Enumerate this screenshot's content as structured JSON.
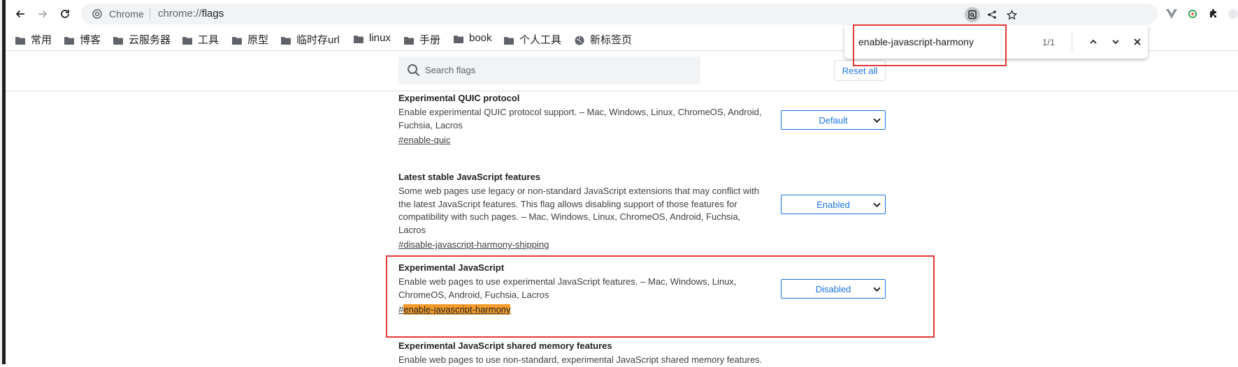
{
  "browser": {
    "omnibox": {
      "chip_label": "Chrome",
      "url_scheme": "chrome://",
      "url_path": "flags"
    }
  },
  "bookmarks": [
    {
      "label": "常用",
      "icon": "folder-icon"
    },
    {
      "label": "博客",
      "icon": "folder-icon"
    },
    {
      "label": "云服务器",
      "icon": "folder-icon"
    },
    {
      "label": "工具",
      "icon": "folder-icon"
    },
    {
      "label": "原型",
      "icon": "folder-icon"
    },
    {
      "label": "临时存url",
      "icon": "folder-icon"
    },
    {
      "label": "linux",
      "icon": "folder-icon"
    },
    {
      "label": "手册",
      "icon": "folder-icon"
    },
    {
      "label": "book",
      "icon": "folder-icon"
    },
    {
      "label": "个人工具",
      "icon": "folder-icon"
    },
    {
      "label": "新标签页",
      "icon": "globe-icon"
    }
  ],
  "findbar": {
    "query": "enable-javascript-harmony",
    "count": "1/1"
  },
  "flags_page": {
    "search_placeholder": "Search flags",
    "reset_label": "Reset all",
    "flags": [
      {
        "title": "Experimental QUIC protocol",
        "description": "Enable experimental QUIC protocol support. – Mac, Windows, Linux, ChromeOS, Android, Fuchsia, Lacros",
        "link": "#enable-quic",
        "value": "Default"
      },
      {
        "title": "Latest stable JavaScript features",
        "description": "Some web pages use legacy or non-standard JavaScript extensions that may conflict with the latest JavaScript features. This flag allows disabling support of those features for compatibility with such pages. – Mac, Windows, Linux, ChromeOS, Android, Fuchsia, Lacros",
        "link": "#disable-javascript-harmony-shipping",
        "value": "Enabled"
      },
      {
        "title": "Experimental JavaScript",
        "description": "Enable web pages to use experimental JavaScript features. – Mac, Windows, Linux, ChromeOS, Android, Fuchsia, Lacros",
        "link_prefix": "#",
        "link_match": "enable-javascript-harmony",
        "value": "Disabled"
      },
      {
        "title": "Experimental JavaScript shared memory features",
        "description": "Enable web pages to use non-standard, experimental JavaScript shared memory features."
      }
    ]
  },
  "colors": {
    "accent": "#1a73e8",
    "find_match": "#f39c2b",
    "annotation_red": "#e53935"
  }
}
